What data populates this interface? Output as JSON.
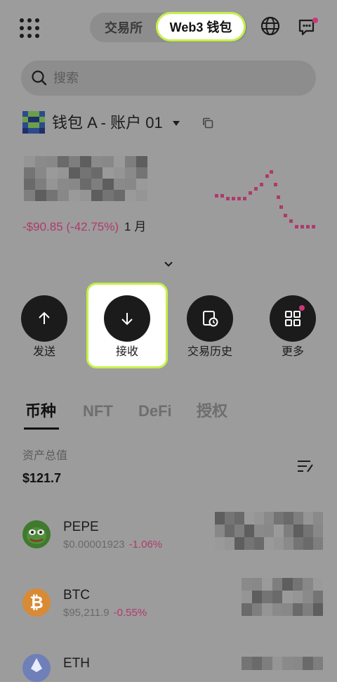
{
  "topbar": {
    "tab_exchange": "交易所",
    "tab_web3": "Web3 钱包"
  },
  "search": {
    "placeholder": "搜索"
  },
  "account": {
    "name": "钱包 A - 账户 01"
  },
  "balance": {
    "pnl_value": "-$90.85 (-42.75%)",
    "pnl_period": "1 月"
  },
  "actions": [
    {
      "label": "发送",
      "icon": "arrow-up-icon"
    },
    {
      "label": "接收",
      "icon": "arrow-down-icon"
    },
    {
      "label": "交易历史",
      "icon": "history-icon"
    },
    {
      "label": "更多",
      "icon": "grid-more-icon"
    }
  ],
  "tabs": [
    "币种",
    "NFT",
    "DeFi",
    "授权"
  ],
  "assets": {
    "total_label": "资产总值",
    "total_value": "$121.7",
    "list": [
      {
        "name": "PEPE",
        "price": "$0.00001923",
        "change": "-1.06%",
        "icon": "pepe-icon"
      },
      {
        "name": "BTC",
        "price": "$95,211.9",
        "change": "-0.55%",
        "icon": "bitcoin-icon"
      },
      {
        "name": "ETH",
        "price": "",
        "change": "",
        "icon": "ethereum-icon"
      }
    ]
  },
  "colors": {
    "accent": "#c5f04a",
    "negative": "#b03a6a",
    "overlay": "#9c9c9c"
  }
}
